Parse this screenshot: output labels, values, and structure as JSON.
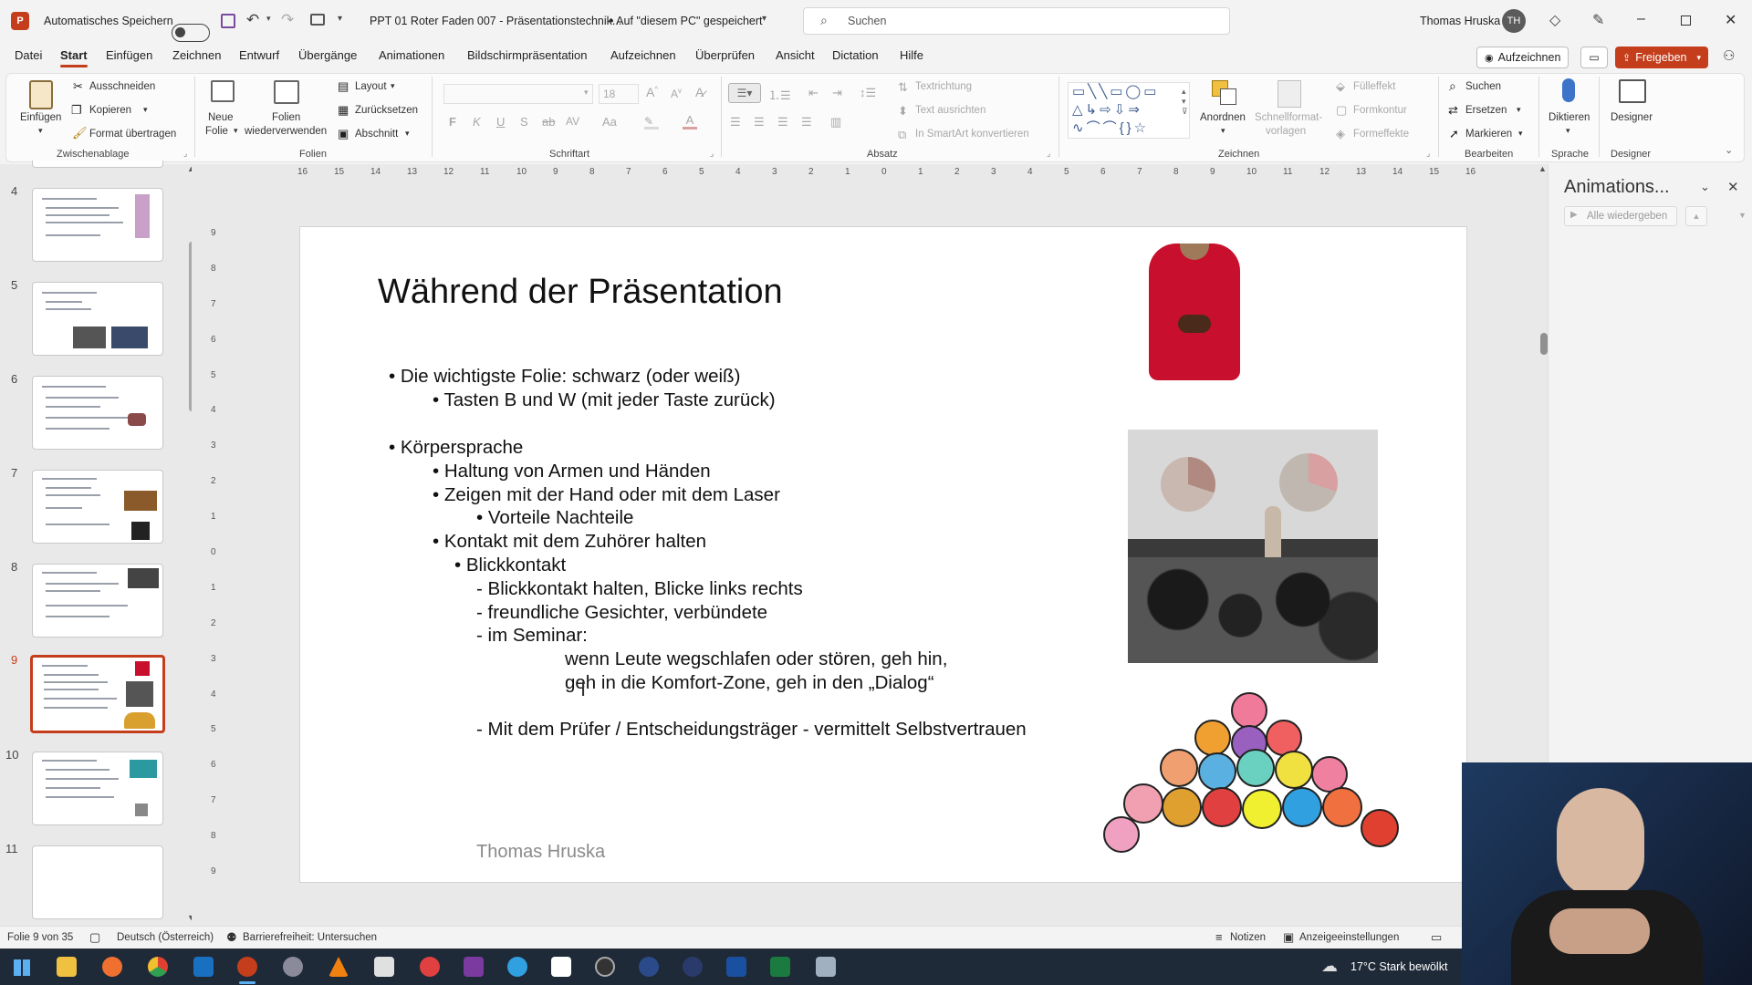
{
  "titlebar": {
    "autosave_label": "Automatisches Speichern",
    "doc_title": "PPT 01 Roter Faden 007 - Präsentationstechnik...",
    "save_location": "• Auf \"diesem PC\" gespeichert",
    "search_placeholder": "Suchen",
    "user_name": "Thomas Hruska",
    "user_initials": "TH"
  },
  "menu": {
    "items": [
      "Datei",
      "Start",
      "Einfügen",
      "Zeichnen",
      "Entwurf",
      "Übergänge",
      "Animationen",
      "Bildschirmpräsentation",
      "Aufzeichnen",
      "Überprüfen",
      "Ansicht",
      "Dictation",
      "Hilfe"
    ],
    "record_label": "Aufzeichnen",
    "share_label": "Freigeben"
  },
  "ribbon": {
    "clipboard": {
      "paste": "Einfügen",
      "cut": "Ausschneiden",
      "copy": "Kopieren",
      "format_painter": "Format übertragen",
      "group": "Zwischenablage"
    },
    "slides": {
      "new_slide_1": "Neue",
      "new_slide_2": "Folie",
      "reuse_1": "Folien",
      "reuse_2": "wiederverwenden",
      "layout": "Layout",
      "reset": "Zurücksetzen",
      "section": "Abschnitt",
      "group": "Folien"
    },
    "font": {
      "size": "18",
      "group": "Schriftart"
    },
    "paragraph": {
      "text_direction": "Textrichtung",
      "align_text": "Text ausrichten",
      "smartart": "In SmartArt konvertieren",
      "group": "Absatz"
    },
    "drawing": {
      "arrange": "Anordnen",
      "quick_styles_1": "Schnellformat-",
      "quick_styles_2": "vorlagen",
      "fill": "Fülleffekt",
      "outline": "Formkontur",
      "effects": "Formeffekte",
      "group": "Zeichnen"
    },
    "editing": {
      "find": "Suchen",
      "replace": "Ersetzen",
      "select": "Markieren",
      "group": "Bearbeiten"
    },
    "voice": {
      "dictate": "Diktieren",
      "group": "Sprache"
    },
    "designer": {
      "label": "Designer",
      "group": "Designer"
    }
  },
  "thumbnails": {
    "numbers": [
      "4",
      "5",
      "6",
      "7",
      "8",
      "9",
      "10",
      "11"
    ],
    "selected": "9"
  },
  "rulers": {
    "h_ticks": [
      "16",
      "15",
      "14",
      "13",
      "12",
      "11",
      "10",
      "9",
      "8",
      "7",
      "6",
      "5",
      "4",
      "3",
      "2",
      "1",
      "0",
      "1",
      "2",
      "3",
      "4",
      "5",
      "6",
      "7",
      "8",
      "9",
      "10",
      "11",
      "12",
      "13",
      "14",
      "15",
      "16"
    ],
    "v_ticks": [
      "9",
      "8",
      "7",
      "6",
      "5",
      "4",
      "3",
      "2",
      "1",
      "0",
      "1",
      "2",
      "3",
      "4",
      "5",
      "6",
      "7",
      "8",
      "9"
    ]
  },
  "slide": {
    "title": "Während der Präsentation",
    "lines": [
      "•  Die wichtigste Folie: schwarz (oder weiß)",
      "•  Tasten   B   und   W   (mit jeder Taste zurück)",
      "•  Körpersprache",
      "•  Haltung von Armen und Händen",
      "•  Zeigen mit der Hand oder mit dem Laser",
      "•  Vorteile Nachteile",
      "•  Kontakt mit dem Zuhörer halten",
      "•  Blickkontakt",
      "- Blickkontakt halten, Blicke links rechts",
      "- freundliche Gesichter, verbündete",
      "- im Seminar:",
      "wenn Leute wegschlafen oder stören, geh hin,",
      "geh in die Komfort-Zone, geh in den „Dialog“",
      "- Mit dem Prüfer / Entscheidungsträger - vermittelt Selbstvertrauen"
    ],
    "footer": "Thomas Hruska"
  },
  "animpane": {
    "title": "Animations...",
    "play_all": "Alle wiedergeben"
  },
  "statusbar": {
    "slide_info": "Folie 9 von 35",
    "language": "Deutsch (Österreich)",
    "accessibility": "Barrierefreiheit: Untersuchen",
    "notes": "Notizen",
    "display_settings": "Anzeigeeinstellungen"
  },
  "taskbar": {
    "weather": "17°C  Stark bewölkt"
  },
  "colors": {
    "accent": "#c43e1c",
    "ribbon_bg": "#fbfbfb",
    "taskbar": "#1f2a38"
  }
}
